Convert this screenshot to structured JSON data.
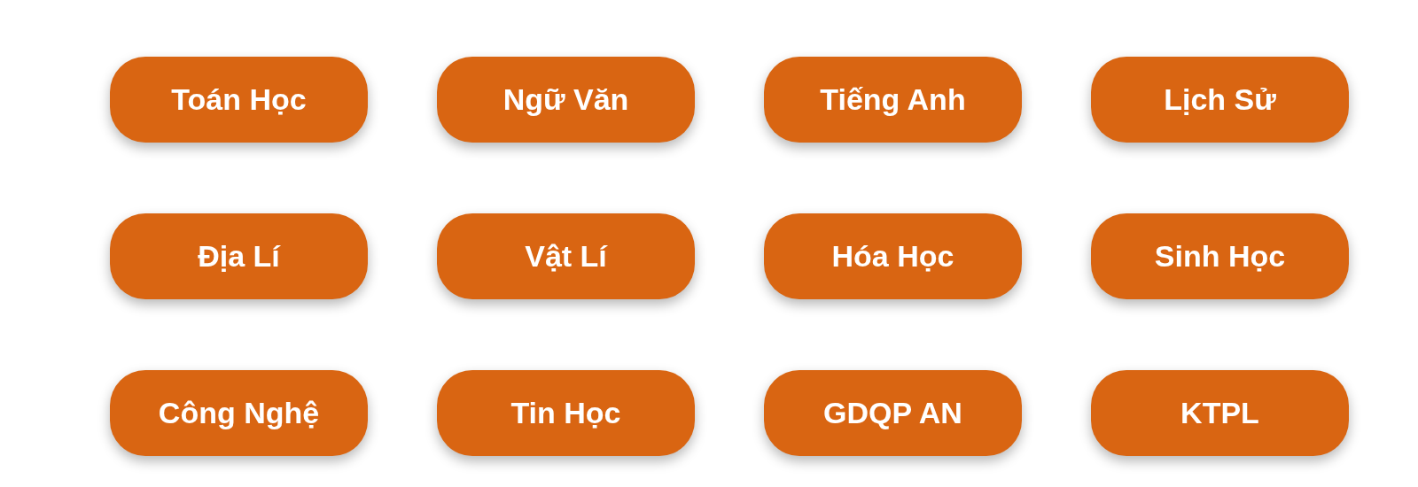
{
  "subjects": [
    {
      "label": "Toán Học"
    },
    {
      "label": "Ngữ Văn"
    },
    {
      "label": "Tiếng Anh"
    },
    {
      "label": "Lịch Sử"
    },
    {
      "label": "Địa Lí"
    },
    {
      "label": "Vật Lí"
    },
    {
      "label": "Hóa Học"
    },
    {
      "label": "Sinh Học"
    },
    {
      "label": "Công Nghệ"
    },
    {
      "label": "Tin Học"
    },
    {
      "label": "GDQP AN"
    },
    {
      "label": "KTPL"
    }
  ]
}
